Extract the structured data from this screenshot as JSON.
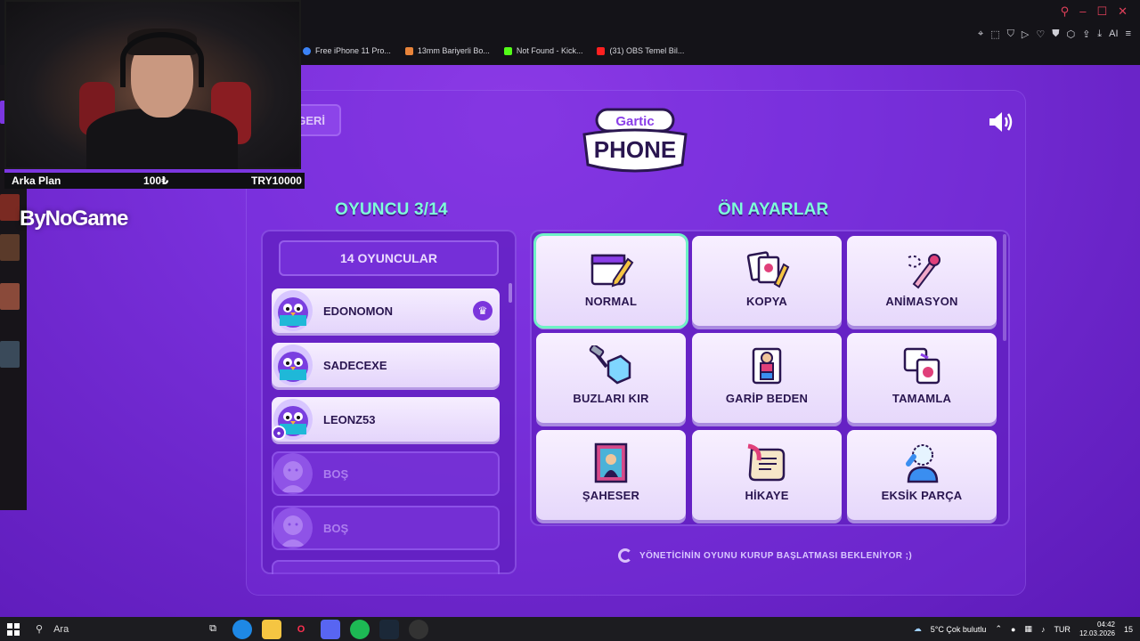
{
  "browser": {
    "bookmarks": [
      {
        "label": "Free iPhone 11 Pro...",
        "color": "#3b82f6"
      },
      {
        "label": "13mm Bariyerli Bo...",
        "color": "#e8843a"
      },
      {
        "label": "Not Found - Kick...",
        "color": "#53fc18"
      },
      {
        "label": "(31) OBS Temel Bil...",
        "color": "#ff2020"
      }
    ],
    "toolbar_icons": [
      "pin-icon",
      "screenshot-icon",
      "shield-icon",
      "play-icon",
      "heart-icon",
      "vpn-icon",
      "extensions-icon",
      "share-icon",
      "download-icon",
      "ai-icon",
      "menu-icon"
    ],
    "ai_label": "AI"
  },
  "stream_overlay": {
    "donation_label": "Arka Plan",
    "donation_amount": "100₺",
    "donation_goal": "TRY10000",
    "brand": "ByNoGame"
  },
  "game": {
    "back_label": "GERİ",
    "logo_top": "Gartic",
    "logo_bottom": "PHONE",
    "players_title": "OYUNCU 3/14",
    "presets_title": "ÖN AYARLAR",
    "players_count_label": "14 OYUNCULAR",
    "players": [
      {
        "name": "EDONOMON",
        "host": true,
        "self": false
      },
      {
        "name": "SADECEXE",
        "host": false,
        "self": false
      },
      {
        "name": "LEONZ53",
        "host": false,
        "self": true
      }
    ],
    "empty_slots": [
      {
        "name": "BOŞ"
      },
      {
        "name": "BOŞ"
      }
    ],
    "presets": [
      {
        "label": "NORMAL",
        "icon": "calendar-pencil-icon",
        "selected": true
      },
      {
        "label": "KOPYA",
        "icon": "copy-cards-icon",
        "selected": false
      },
      {
        "label": "ANİMASYON",
        "icon": "animation-pen-icon",
        "selected": false
      },
      {
        "label": "BUZLARI KIR",
        "icon": "ice-hammer-icon",
        "selected": false
      },
      {
        "label": "GARİP BEDEN",
        "icon": "weird-body-icon",
        "selected": false
      },
      {
        "label": "TAMAMLA",
        "icon": "complete-picture-icon",
        "selected": false
      },
      {
        "label": "ŞAHESER",
        "icon": "masterpiece-portrait-icon",
        "selected": false
      },
      {
        "label": "HİKAYE",
        "icon": "story-scroll-icon",
        "selected": false
      },
      {
        "label": "EKSİK PARÇA",
        "icon": "missing-piece-icon",
        "selected": false
      }
    ],
    "waiting_text": "YÖNETİCİNİN OYUNU KURUP BAŞLATMASI BEKLENİYOR ;)"
  },
  "taskbar": {
    "search_placeholder": "Ara",
    "weather": "5°C  Çok bulutlu",
    "language": "TUR",
    "time": "04:42",
    "date": "12.03.2026",
    "notifications": "15",
    "apps": [
      "edge-icon",
      "file-explorer-icon",
      "opera-gx-icon",
      "discord-icon",
      "spotify-icon",
      "steam-icon",
      "obs-icon"
    ]
  },
  "colors": {
    "accent": "#7effd9",
    "purple_bg": "#7a30dc",
    "card": "#f1e6ff",
    "text_dark": "#2a1650"
  }
}
